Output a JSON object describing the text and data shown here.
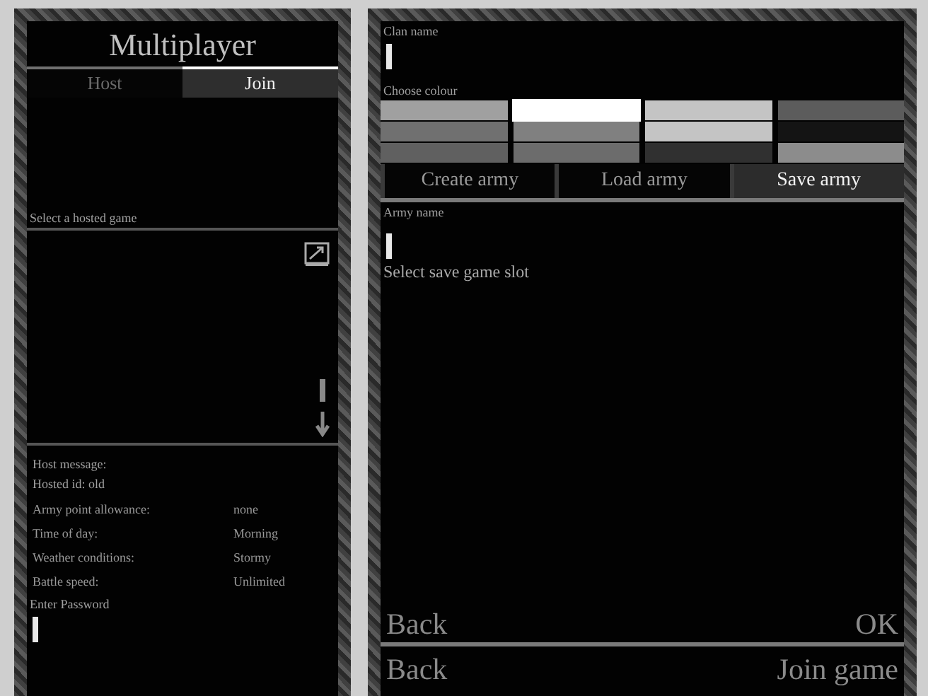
{
  "left": {
    "title": "Multiplayer",
    "tabs": [
      {
        "label": "Host",
        "selected": false
      },
      {
        "label": "Join",
        "selected": true
      }
    ],
    "list_label": "Select a hosted game",
    "info": [
      "Host message:",
      "Hosted id: old"
    ],
    "settings": [
      {
        "label": "Army point allowance:",
        "value": "none"
      },
      {
        "label": "Time of day:",
        "value": "Morning"
      },
      {
        "label": "Weather conditions:",
        "value": "Stormy"
      },
      {
        "label": "Battle speed:",
        "value": "Unlimited"
      }
    ],
    "password_label": "Enter Password"
  },
  "right": {
    "clan_label": "Clan name",
    "colour_label": "Choose colour",
    "swatches": [
      {
        "color": "#a0a0a0",
        "selected": false
      },
      {
        "color": "#ffffff",
        "selected": true
      },
      {
        "color": "#c4c4c4",
        "selected": false
      },
      {
        "color": "#5c5c5c",
        "selected": false
      },
      {
        "color": "#707070",
        "selected": false
      },
      {
        "color": "#808080",
        "selected": false
      },
      {
        "color": "#c4c4c4",
        "selected": false
      },
      {
        "color": "#141414",
        "selected": false
      },
      {
        "color": "#606060",
        "selected": false
      },
      {
        "color": "#6c6c6c",
        "selected": false
      },
      {
        "color": "#303030",
        "selected": false
      },
      {
        "color": "#8c8c8c",
        "selected": false
      }
    ],
    "tabs": [
      {
        "label": "Create army",
        "selected": false
      },
      {
        "label": "Load army",
        "selected": false
      },
      {
        "label": "Save army",
        "selected": true
      }
    ],
    "army_label": "Army name",
    "slot_label": "Select save game slot",
    "inner_buttons": [
      "Back",
      "OK"
    ]
  },
  "footer": {
    "buttons": [
      "Back",
      "Join game"
    ]
  }
}
